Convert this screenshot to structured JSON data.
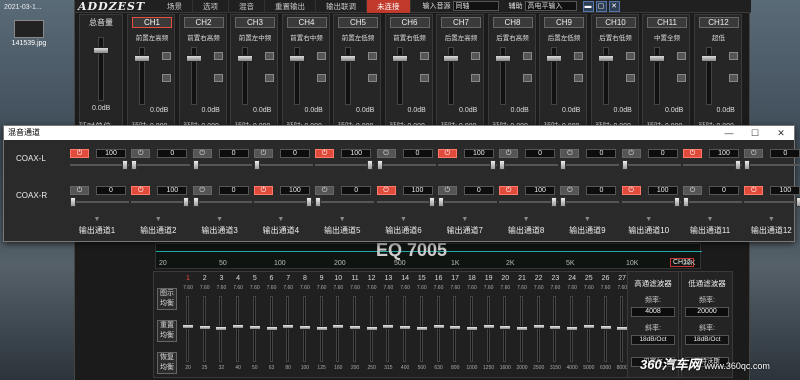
{
  "desktop": {
    "icon_date": "2021-03-1...",
    "icon_label": "141539.jpg"
  },
  "app": {
    "logo": "ADDZEST",
    "menu": [
      "场景",
      "选项",
      "混音",
      "重置输出",
      "输出联调"
    ],
    "status": "未连接",
    "input_source_label": "输入音源",
    "input_source_value": "同轴",
    "aux_label": "辅助",
    "aux_value": "高电平输入",
    "window_buttons": [
      "minimize",
      "maximize",
      "close"
    ]
  },
  "master": {
    "title": "总音量",
    "db": "0.0dB",
    "delay_unit_label": "延时单位"
  },
  "channels": [
    {
      "label": "CH1",
      "mode": "前置左高频",
      "db": "0.0dB",
      "active": true
    },
    {
      "label": "CH2",
      "mode": "前置右高频",
      "db": "0.0dB"
    },
    {
      "label": "CH3",
      "mode": "前置左中频",
      "db": "0.0dB"
    },
    {
      "label": "CH4",
      "mode": "前置右中频",
      "db": "0.0dB"
    },
    {
      "label": "CH5",
      "mode": "前置左低频",
      "db": "0.0dB"
    },
    {
      "label": "CH6",
      "mode": "前置右低频",
      "db": "0.0dB"
    },
    {
      "label": "CH7",
      "mode": "后置左高频",
      "db": "0.0dB"
    },
    {
      "label": "CH8",
      "mode": "后置右高频",
      "db": "0.0dB"
    },
    {
      "label": "CH9",
      "mode": "后置左低频",
      "db": "0.0dB"
    },
    {
      "label": "CH10",
      "mode": "后置右低频",
      "db": "0.0dB"
    },
    {
      "label": "CH11",
      "mode": "中置全频",
      "db": "0.0dB"
    },
    {
      "label": "CH12",
      "mode": "超低",
      "db": "0.0dB"
    }
  ],
  "channel_delay_prefix": "延时:",
  "channel_delay_value": "0.000",
  "dialog": {
    "title": "混音通道",
    "rows": [
      {
        "label": "COAX-L",
        "values": [
          "100",
          "0",
          "0",
          "0",
          "100",
          "0",
          "100",
          "0",
          "0",
          "0",
          "100",
          "0"
        ],
        "power": [
          true,
          false,
          false,
          false,
          true,
          false,
          true,
          false,
          false,
          false,
          true,
          false
        ]
      },
      {
        "label": "COAX-R",
        "values": [
          "0",
          "100",
          "0",
          "100",
          "0",
          "100",
          "0",
          "100",
          "0",
          "100",
          "0",
          "100"
        ],
        "power": [
          false,
          true,
          false,
          true,
          false,
          true,
          false,
          true,
          false,
          true,
          false,
          true
        ]
      }
    ],
    "outputs": [
      "输出通道1",
      "输出通道2",
      "输出通道3",
      "输出通道4",
      "输出通道5",
      "输出通道6",
      "输出通道7",
      "输出通道8",
      "输出通道9",
      "输出通道10",
      "输出通道11",
      "输出通道12"
    ]
  },
  "eq_graph": {
    "freq_labels": [
      "20",
      "50",
      "100",
      "200",
      "500",
      "1K",
      "2K",
      "5K",
      "10K",
      "20K"
    ],
    "ch_tag": "CH12",
    "brand_partial": "EQ 7005"
  },
  "eq_panel": {
    "side_buttons": [
      "图示均衡",
      "重置均衡",
      "恢复均衡"
    ],
    "band_gain": "7.60",
    "bands": [
      "1",
      "2",
      "3",
      "4",
      "5",
      "6",
      "7",
      "8",
      "9",
      "10",
      "11",
      "12",
      "13",
      "14",
      "15",
      "16",
      "17",
      "18",
      "19",
      "20",
      "21",
      "22",
      "23",
      "24",
      "25",
      "26",
      "27",
      "28",
      "29",
      "30",
      "31"
    ],
    "freqs": [
      "20",
      "25",
      "32",
      "40",
      "50",
      "63",
      "80",
      "100",
      "125",
      "160",
      "200",
      "250",
      "315",
      "400",
      "500",
      "630",
      "800",
      "1000",
      "1250",
      "1600",
      "2000",
      "2500",
      "3150",
      "4000",
      "5000",
      "6300",
      "8000",
      "10000",
      "12500",
      "16000",
      "20000"
    ]
  },
  "filters": {
    "highpass": {
      "title": "高通滤波器",
      "freq_label": "频率:",
      "freq": "4008",
      "slope_label": "斜率:",
      "slope": "18dB/Oct",
      "type": "贝塞尔"
    },
    "lowpass": {
      "title": "低通滤波器",
      "freq_label": "频率:",
      "freq": "20000",
      "slope_label": "斜率:",
      "slope": "18dB/Oct",
      "type": "巴特沃斯"
    }
  },
  "watermark": {
    "brand": "360汽车网",
    "site": "www.360qc.com"
  }
}
